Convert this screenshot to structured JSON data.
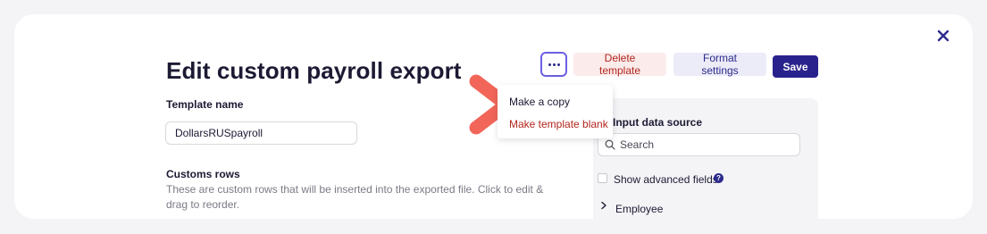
{
  "header": {
    "title": "Edit custom payroll export"
  },
  "toolbar": {
    "more_icon": "ellipsis-icon",
    "delete_label": "Delete template",
    "format_label": "Format settings",
    "save_label": "Save",
    "close_icon": "close-icon"
  },
  "menu": {
    "items": [
      {
        "label": "Make a copy",
        "tone": "default"
      },
      {
        "label": "Make template blank",
        "tone": "danger"
      }
    ]
  },
  "form": {
    "template_name_label": "Template name",
    "template_name_value": "DollarsRUSpayroll",
    "custom_rows_label": "Customs rows",
    "custom_rows_hint": "These are custom rows that will be inserted into the exported file. Click to edit & drag to reorder."
  },
  "panel": {
    "title": "Input data source",
    "search_placeholder": "Search",
    "advanced_label": "Show advanced fields",
    "advanced_checked": false,
    "tree_items": [
      {
        "label": "Employee"
      }
    ]
  },
  "colors": {
    "brand": "#2a228c",
    "danger": "#b3261e",
    "arrow": "#f26659"
  }
}
